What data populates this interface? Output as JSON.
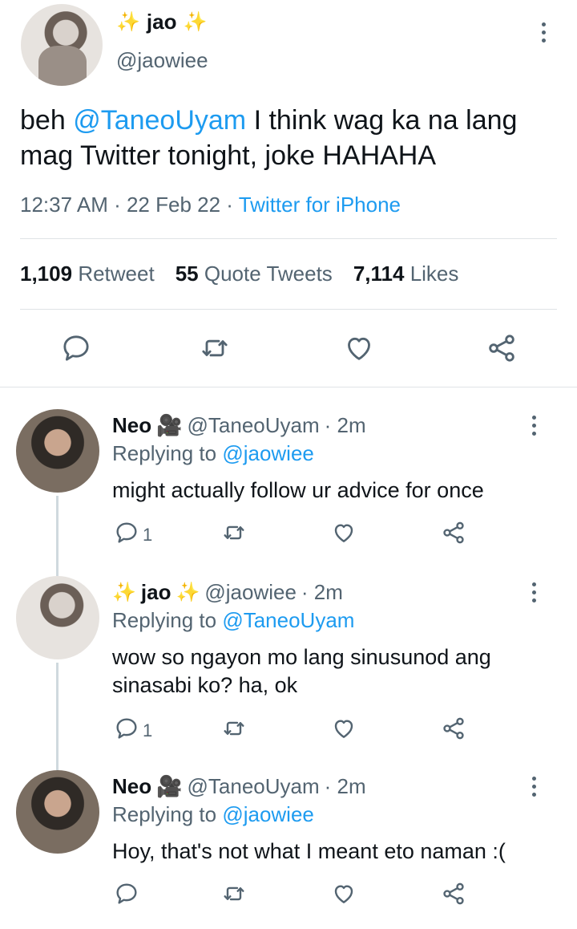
{
  "main_tweet": {
    "name": "jao",
    "name_decoration": "sparkles-icon",
    "handle": "@jaowiee",
    "text_parts": {
      "before": "beh ",
      "mention": "@TaneoUyam",
      "after": " I think wag ka na lang mag Twitter tonight, joke HAHAHA"
    },
    "time": "12:37 AM",
    "dot1": " · ",
    "date": "22 Feb 22",
    "dot2": " · ",
    "source": "Twitter for iPhone",
    "stats": {
      "retweets_count": "1,109",
      "retweets_label": "Retweet",
      "quotes_count": "55",
      "quotes_label": "Quote Tweets",
      "likes_count": "7,114",
      "likes_label": "Likes"
    }
  },
  "replies": [
    {
      "name": "Neo",
      "name_emoji": "🎥",
      "handle": "@TaneoUyam",
      "time": "· 2m",
      "replying_label": "Replying to ",
      "replying_to": "@jaowiee",
      "text": "might actually follow ur advice for once",
      "reply_count": "1"
    },
    {
      "name": "jao",
      "name_decoration": "sparkles-icon",
      "handle": "@jaowiee",
      "time": "· 2m",
      "replying_label": "Replying to ",
      "replying_to": "@TaneoUyam",
      "text": "wow so ngayon mo lang sinusunod ang sinasabi ko? ha, ok",
      "reply_count": "1"
    },
    {
      "name": "Neo",
      "name_emoji": "🎥",
      "handle": "@TaneoUyam",
      "time": "· 2m",
      "replying_label": "Replying to ",
      "replying_to": "@jaowiee",
      "text": "Hoy, that's not what I meant eto naman :(",
      "reply_count": ""
    }
  ],
  "colors": {
    "link": "#1d9bf0",
    "muted": "#536471",
    "text": "#0f1419",
    "divider": "#dfe3e6",
    "sparkle": "#e8b400"
  }
}
